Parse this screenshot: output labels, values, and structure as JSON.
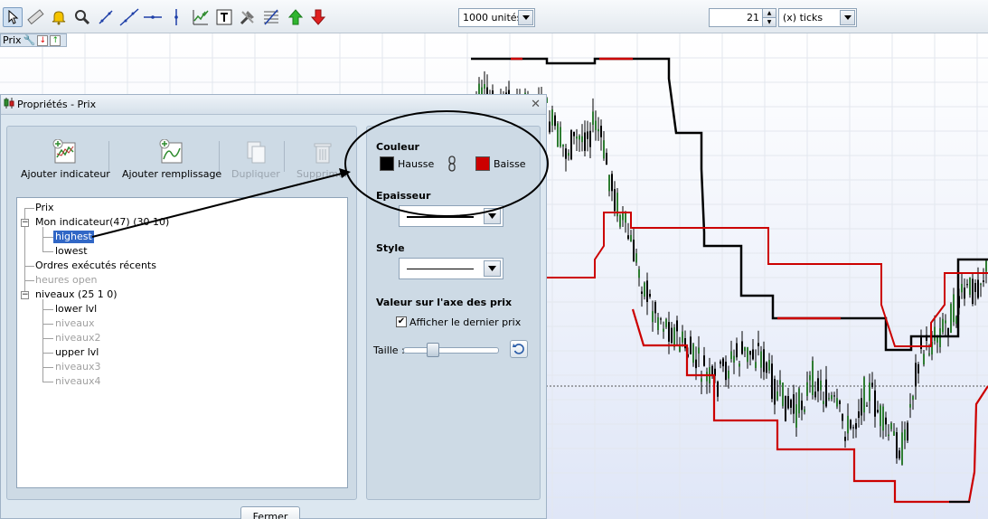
{
  "toolbar": {
    "icons": [
      "pointer-icon",
      "ruler-icon",
      "alert-bell-icon",
      "zoom-icon",
      "trend-line-icon",
      "extended-line-icon",
      "horizontal-line-icon",
      "vertical-line-icon",
      "indicator-icon",
      "text-icon",
      "tools-icon",
      "fibonacci-icon",
      "buy-arrow-icon",
      "sell-arrow-icon"
    ],
    "units_select": "1000 unités",
    "ticks_value": "21",
    "ticks_select": "(x) ticks"
  },
  "price_bar": {
    "label": "Prix"
  },
  "dialog": {
    "title": "Propriétés - Prix",
    "close_label": "✕",
    "buttons": {
      "add_indicator": "Ajouter indicateur",
      "add_fill": "Ajouter remplissage",
      "duplicate": "Dupliquer",
      "delete": "Supprimer"
    },
    "tree": {
      "prix": "Prix",
      "mon_indicateur": "Mon indicateur(47) (30 10)",
      "highest": "highest",
      "lowest": "lowest",
      "ordres": "Ordres exécutés récents",
      "heures_open": "heures open",
      "niveaux": "niveaux (25 1 0)",
      "lower_lvl": "lower lvl",
      "niveaux_1": "niveaux",
      "niveaux2": "niveaux2",
      "upper_lvl": "upper lvl",
      "niveaux3": "niveaux3",
      "niveaux4": "niveaux4"
    },
    "properties": {
      "color_title": "Couleur",
      "hausse_label": "Hausse",
      "baisse_label": "Baisse",
      "hausse_color": "#000000",
      "baisse_color": "#cc0000",
      "thickness_title": "Epaisseur",
      "style_title": "Style",
      "axis_title": "Valeur sur l'axe des prix",
      "show_last_price_label": "Afficher le dernier prix",
      "show_last_price_checked": true,
      "size_label": "Taille :"
    },
    "close_button": "Fermer"
  },
  "colors": {
    "highest_line": "#000000",
    "lowest_line": "#cc0000",
    "candle_up": "#2e7d32",
    "candle_down": "#000000"
  }
}
